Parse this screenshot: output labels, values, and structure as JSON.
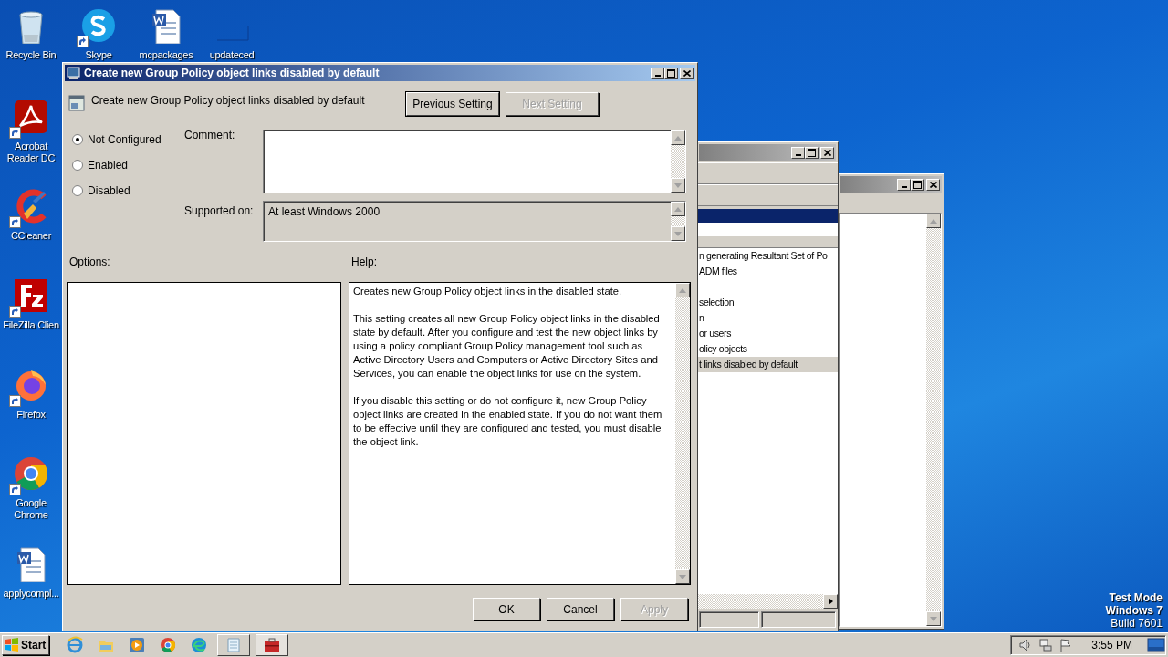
{
  "desktop_icons": [
    {
      "label": "Recycle Bin",
      "kind": "recycle",
      "shortcut": false
    },
    {
      "label": "Skype",
      "kind": "skype",
      "shortcut": true
    },
    {
      "label": "mcpackages",
      "kind": "word",
      "shortcut": false
    },
    {
      "label": "updateced",
      "kind": "blank",
      "shortcut": false
    },
    {
      "label": "Acrobat Reader DC",
      "kind": "acrobat",
      "shortcut": true
    },
    {
      "label": "CCleaner",
      "kind": "ccleaner",
      "shortcut": true
    },
    {
      "label": "FileZilla Clien",
      "kind": "filezilla",
      "shortcut": true
    },
    {
      "label": "Firefox",
      "kind": "firefox",
      "shortcut": true
    },
    {
      "label": "Google Chrome",
      "kind": "chrome",
      "shortcut": true
    },
    {
      "label": "applycompl...",
      "kind": "word",
      "shortcut": false
    }
  ],
  "back_window": {
    "items": [
      {
        "kind": "text",
        "text": "n generating Resultant Set of Po",
        "selected": false
      },
      {
        "kind": "text",
        "text": "ADM files",
        "selected": false
      },
      {
        "kind": "blank",
        "selected": false
      },
      {
        "kind": "text",
        "text": "selection",
        "selected": false
      },
      {
        "kind": "text",
        "text": "n",
        "selected": false
      },
      {
        "kind": "text",
        "text": "or users",
        "selected": false
      },
      {
        "kind": "text",
        "text": "olicy objects",
        "selected": false
      },
      {
        "kind": "text",
        "text": "t links disabled by default",
        "selected": true
      }
    ]
  },
  "dialog": {
    "title": "Create new Group Policy object links disabled by default",
    "setting_name": "Create new Group Policy object links disabled by default",
    "nav_buttons": [
      {
        "label": "Previous Setting",
        "disabled": false
      },
      {
        "label": "Next Setting",
        "disabled": true
      }
    ],
    "options": [
      {
        "label": "Not Configured",
        "selected": true
      },
      {
        "label": "Enabled",
        "selected": false
      },
      {
        "label": "Disabled",
        "selected": false
      }
    ],
    "comment_label": "Comment:",
    "supported_label": "Supported on:",
    "supported_value": "At least Windows 2000",
    "options_label": "Options:",
    "help_label": "Help:",
    "help_paragraphs": [
      "Creates new Group Policy object links in the disabled state.",
      "This setting creates all new Group Policy object links in the disabled state by default. After you configure and test the new object links by using a policy compliant Group Policy management tool such as  Active Directory Users and Computers or Active Directory Sites and Services, you can enable the object links for use on the system.",
      "If you disable this setting or do not configure it, new Group Policy object links are created in the enabled state. If you do not want them to be effective until they are configured and tested, you must disable the object link."
    ],
    "footer_buttons": [
      {
        "label": "OK",
        "disabled": false
      },
      {
        "label": "Cancel",
        "disabled": false
      },
      {
        "label": "Apply",
        "disabled": true
      }
    ]
  },
  "desktop_notice": [
    "Test Mode",
    "Windows 7",
    "Build 7601"
  ],
  "taskbar": {
    "start": "Start",
    "buttons": [
      {
        "kind": "ie",
        "selected": false
      },
      {
        "kind": "explorer",
        "selected": false
      },
      {
        "kind": "media",
        "selected": false
      },
      {
        "kind": "chrome",
        "selected": false
      },
      {
        "kind": "edge",
        "selected": false
      },
      {
        "kind": "notepad",
        "selected": false
      },
      {
        "kind": "policy",
        "selected": true
      }
    ],
    "clock": "3:55 PM"
  }
}
